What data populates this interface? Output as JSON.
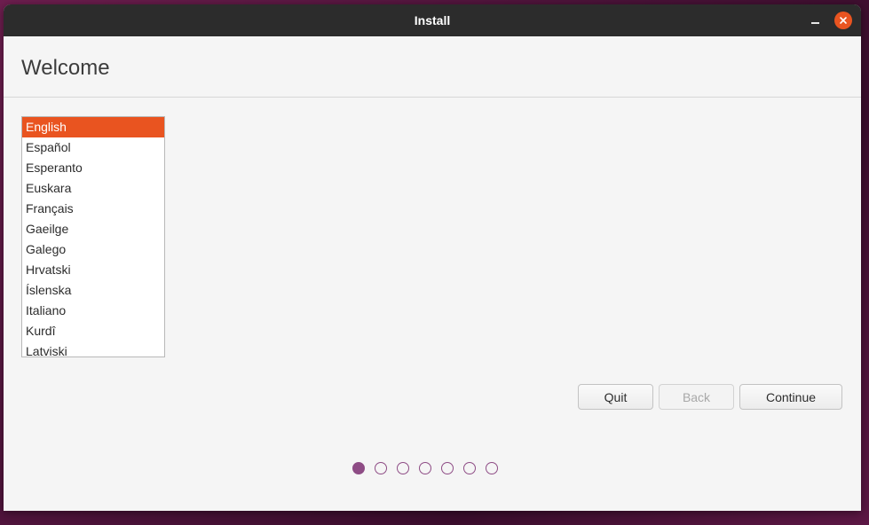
{
  "window": {
    "title": "Install"
  },
  "page": {
    "heading": "Welcome"
  },
  "languages": {
    "selected_index": 0,
    "items": [
      "English",
      "Español",
      "Esperanto",
      "Euskara",
      "Français",
      "Gaeilge",
      "Galego",
      "Hrvatski",
      "Íslenska",
      "Italiano",
      "Kurdî",
      "Latviski"
    ]
  },
  "buttons": {
    "quit": "Quit",
    "back": "Back",
    "continue": "Continue"
  },
  "progress": {
    "total_steps": 7,
    "current_step": 1
  },
  "colors": {
    "accent": "#e95420",
    "progress_dot": "#8e4c85",
    "titlebar": "#2c2c2c"
  },
  "icons": {
    "minimize": "minimize-icon",
    "close": "close-icon"
  }
}
